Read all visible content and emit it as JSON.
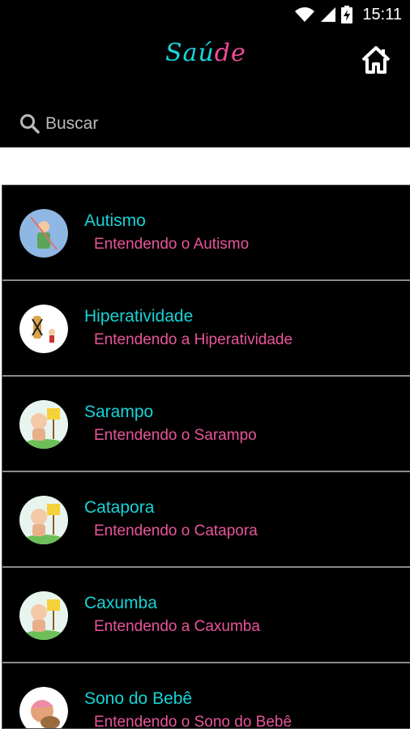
{
  "status_bar": {
    "time": "15:11",
    "icons": [
      "wifi-icon",
      "signal-icon",
      "battery-charging-icon"
    ]
  },
  "app_bar": {
    "logo_part1": "Saú",
    "logo_part2": "de",
    "home_icon": "home-icon",
    "colors": {
      "accent_cyan": "#19d7de",
      "accent_pink": "#ee4d9a"
    }
  },
  "search": {
    "icon": "search-icon",
    "placeholder": "Buscar"
  },
  "list": {
    "items": [
      {
        "title": "Autismo",
        "subtitle": "Entendendo o Autismo",
        "icon": "autism-avatar-icon"
      },
      {
        "title": "Hiperatividade",
        "subtitle": "Entendendo a Hiperatividade",
        "icon": "hyperactivity-avatar-icon"
      },
      {
        "title": "Sarampo",
        "subtitle": "Entendendo o Sarampo",
        "icon": "baby-sign-avatar-icon"
      },
      {
        "title": "Catapora",
        "subtitle": "Entendendo o Catapora",
        "icon": "baby-sign-avatar-icon"
      },
      {
        "title": "Caxumba",
        "subtitle": "Entendendo a Caxumba",
        "icon": "baby-sign-avatar-icon"
      },
      {
        "title": "Sono do Bebê",
        "subtitle": "Entendendo o Sono do Bebê",
        "icon": "sleeping-baby-avatar-icon"
      }
    ]
  }
}
